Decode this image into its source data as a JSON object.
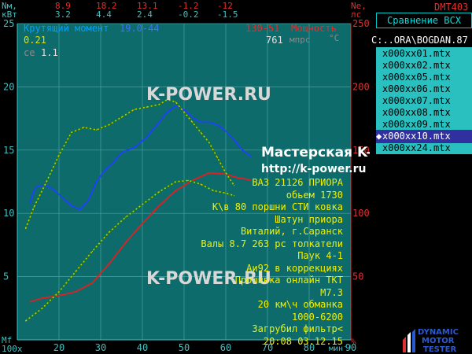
{
  "header": {
    "left_units_top": "Nм,",
    "left_units_bottom": "кВт",
    "right_units_top": "Ne,",
    "right_units_bottom": "лс",
    "app_code": "DMT403",
    "values_row1": [
      "8.9",
      "18.2",
      "13.1",
      "-1.2",
      "-12"
    ],
    "values_row2": [
      "3.2",
      "4.4",
      "2.4",
      "-0.2",
      "-1.5"
    ]
  },
  "legend": {
    "torque_label": "Крутящий момент",
    "torque_range": "19.0-44",
    "power_range": "130-51",
    "power_label": "Мощность",
    "value_021": "0.21",
    "ce_label": "ce",
    "ce_value": "1.1",
    "rpm_readout": "761",
    "rpm_unit": "мпрс",
    "deg_unit": "°C"
  },
  "side_panel": {
    "compare_button": "Сравнение ВСХ",
    "path": "C:..ORA\\BOGDAN.87",
    "files": [
      {
        "name": "x000xx01.mtx",
        "selected": false,
        "marked": false
      },
      {
        "name": "x000xx02.mtx",
        "selected": false,
        "marked": false
      },
      {
        "name": "x000xx05.mtx",
        "selected": false,
        "marked": false
      },
      {
        "name": "x000xx06.mtx",
        "selected": false,
        "marked": false
      },
      {
        "name": "x000xx07.mtx",
        "selected": false,
        "marked": false
      },
      {
        "name": "x000xx08.mtx",
        "selected": false,
        "marked": false
      },
      {
        "name": "x000xx09.mtx",
        "selected": false,
        "marked": false
      },
      {
        "name": "x000xx10.mtx",
        "selected": true,
        "marked": true
      },
      {
        "name": "x000xx24.mtx",
        "selected": false,
        "marked": false
      }
    ],
    "logo_line1": "DYNAMIC",
    "logo_line2": "MOTOR",
    "logo_line3": "TESTER"
  },
  "watermarks": {
    "wm1": "K-POWER.RU",
    "wm2": "K-POWER.RU",
    "studio": "Мастерская K-POWER",
    "url": "http://k-power.ru"
  },
  "notes": [
    "ВАЗ 21126 ПРИОРА",
    "обьем 1730",
    "K\\в 80 поршни СТИ ковка",
    "Шатун приора",
    "Виталий, г.Саранск",
    "Валы 8.7 263 рс толкатели",
    "Паук 4-1",
    "Аи92 в коррекциях",
    "Прошивка онлайн ТКТ",
    "M7.3",
    "20 км\\ч обманка",
    "1000-6200",
    "Загрубил фильтр<",
    "20:08 03.12.15"
  ],
  "axes_text": {
    "mf": "Mf",
    "x_prefix": "100x",
    "x_unit": "мин⁻¹",
    "pct": "%"
  },
  "colors": {
    "plot_bg": "#0e6b6b",
    "grid": "#4aa0a0",
    "torque": "#2040ff",
    "power": "#e02020",
    "torque_ref": "#30a030",
    "power_ref": "#30a030",
    "ref_dots": "#c8c800",
    "left_axis": "#40c0c0",
    "right_axis": "#e03030",
    "notes_text": "#f0f000"
  },
  "chart_data": {
    "type": "line",
    "xlabel": "100x мин⁻¹",
    "ylabel_left": "Nм",
    "ylabel_right": "Ne, лс",
    "xlim": [
      10,
      90
    ],
    "ylim_left": [
      0,
      25
    ],
    "ylim_right": [
      0,
      250
    ],
    "x_ticks": [
      20,
      30,
      40,
      50,
      60,
      70,
      80,
      90
    ],
    "left_ticks": [
      5,
      10,
      15,
      20,
      25
    ],
    "right_ticks": [
      50,
      100,
      150,
      200,
      250
    ],
    "grid": true,
    "series": [
      {
        "name": "Крутящий момент",
        "axis": "left",
        "style": "solid",
        "color": "#2040ff",
        "x": [
          13,
          14,
          15,
          17,
          19,
          21,
          23,
          25,
          27,
          29,
          31,
          33,
          35,
          38,
          41,
          44,
          46,
          48,
          50,
          52,
          54,
          56,
          58,
          60,
          62,
          64,
          66
        ],
        "y": [
          10.8,
          11.8,
          12.2,
          12.2,
          11.8,
          11.2,
          10.6,
          10.3,
          11.0,
          12.5,
          13.4,
          14.0,
          14.8,
          15.2,
          16.0,
          17.2,
          18.0,
          18.5,
          18.2,
          17.6,
          17.2,
          17.2,
          17.0,
          16.5,
          15.8,
          15.0,
          14.5
        ]
      },
      {
        "name": "Мощность",
        "axis": "right",
        "style": "solid",
        "color": "#e02020",
        "x": [
          13,
          16,
          20,
          24,
          28,
          32,
          36,
          40,
          44,
          48,
          52,
          56,
          60,
          63,
          65,
          66
        ],
        "y": [
          30,
          33,
          35,
          38,
          45,
          60,
          77,
          92,
          106,
          118,
          126,
          132,
          131,
          128,
          127,
          126
        ]
      },
      {
        "name": "ref torque",
        "axis": "left",
        "style": "dashed",
        "color": "#c8c800",
        "x": [
          12,
          14,
          17,
          20,
          23,
          26,
          29,
          32,
          35,
          38,
          41,
          44,
          46,
          48,
          50,
          52,
          54,
          56,
          58,
          60,
          62
        ],
        "y": [
          8.8,
          10.5,
          12.5,
          14.6,
          16.4,
          16.8,
          16.6,
          17.0,
          17.6,
          18.2,
          18.4,
          18.6,
          19.0,
          18.8,
          18.0,
          17.2,
          16.4,
          15.6,
          14.4,
          13.2,
          12.2
        ]
      },
      {
        "name": "ref power",
        "axis": "right",
        "style": "dashed",
        "color": "#c8c800",
        "x": [
          12,
          16,
          20,
          24,
          28,
          32,
          36,
          40,
          44,
          48,
          51,
          54,
          57,
          60,
          62
        ],
        "y": [
          15,
          25,
          38,
          54,
          70,
          85,
          97,
          107,
          117,
          125,
          126,
          123,
          118,
          116,
          114
        ]
      }
    ]
  }
}
